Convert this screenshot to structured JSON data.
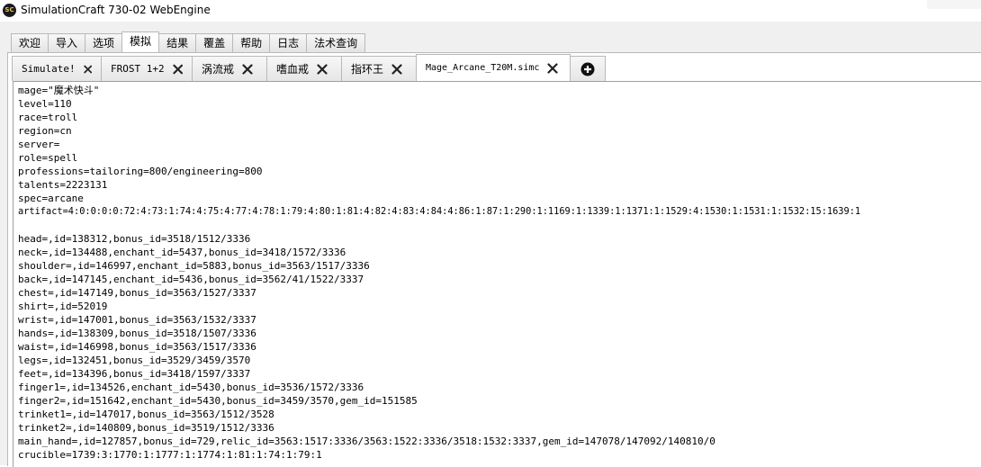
{
  "window": {
    "icon_text": "SC",
    "title": "SimulationCraft 730-02 WebEngine"
  },
  "main_tabs": [
    {
      "label": "欢迎",
      "active": false
    },
    {
      "label": "导入",
      "active": false
    },
    {
      "label": "选项",
      "active": false
    },
    {
      "label": "模拟",
      "active": true
    },
    {
      "label": "结果",
      "active": false
    },
    {
      "label": "覆盖",
      "active": false
    },
    {
      "label": "帮助",
      "active": false
    },
    {
      "label": "日志",
      "active": false
    },
    {
      "label": "法术查询",
      "active": false
    }
  ],
  "sub_tabs": [
    {
      "label": "Simulate!",
      "active": false
    },
    {
      "label": "FROST 1+2",
      "active": false
    },
    {
      "label": "涡流戒",
      "active": false
    },
    {
      "label": "嗜血戒",
      "active": false
    },
    {
      "label": "指环王",
      "active": false
    },
    {
      "label": "Mage_Arcane_T20M.simc",
      "active": true
    }
  ],
  "editor": {
    "lines": [
      "mage=\"魔术快斗\"",
      "level=110",
      "race=troll",
      "region=cn",
      "server=",
      "role=spell",
      "professions=tailoring=800/engineering=800",
      "talents=2223131",
      "spec=arcane",
      "artifact=4:0:0:0:0:72:4:73:1:74:4:75:4:77:4:78:1:79:4:80:1:81:4:82:4:83:4:84:4:86:1:87:1:290:1:1169:1:1339:1:1371:1:1529:4:1530:1:1531:1:1532:15:1639:1",
      "",
      "head=,id=138312,bonus_id=3518/1512/3336",
      "neck=,id=134488,enchant_id=5437,bonus_id=3418/1572/3336",
      "shoulder=,id=146997,enchant_id=5883,bonus_id=3563/1517/3336",
      "back=,id=147145,enchant_id=5436,bonus_id=3562/41/1522/3337",
      "chest=,id=147149,bonus_id=3563/1527/3337",
      "shirt=,id=52019",
      "wrist=,id=147001,bonus_id=3563/1532/3337",
      "hands=,id=138309,bonus_id=3518/1507/3336",
      "waist=,id=146998,bonus_id=3563/1517/3336",
      "legs=,id=132451,bonus_id=3529/3459/3570",
      "feet=,id=134396,bonus_id=3418/1597/3337",
      "finger1=,id=134526,enchant_id=5430,bonus_id=3536/1572/3336",
      "finger2=,id=151642,enchant_id=5430,bonus_id=3459/3570,gem_id=151585",
      "trinket1=,id=147017,bonus_id=3563/1512/3528",
      "trinket2=,id=140809,bonus_id=3519/1512/3336",
      "main_hand=,id=127857,bonus_id=729,relic_id=3563:1517:3336/3563:1522:3336/3518:1532:3337,gem_id=147078/147092/140810/0",
      "crucible=1739:3:1770:1:1777:1:1774:1:81:1:74:1:79:1"
    ]
  }
}
